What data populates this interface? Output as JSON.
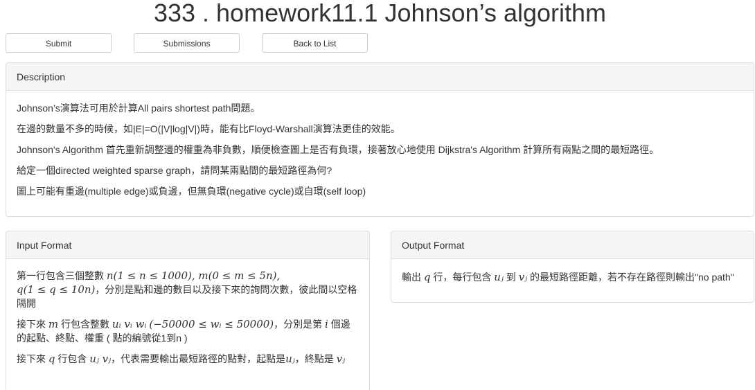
{
  "title": "333 . homework11.1 Johnson’s algorithm",
  "buttons": {
    "submit": "Submit",
    "submissions": "Submissions",
    "back": "Back to List"
  },
  "description": {
    "heading": "Description",
    "lines": [
      "Johnson’s演算法可用於計算All pairs shortest path問題。",
      "在邊的數量不多的時候，如|E|=O(|V|log|V|)時，能有比Floyd-Warshall演算法更佳的效能。",
      "Johnson's Algorithm 首先重新調整邊的權重為非負數，順便檢查圖上是否有負環，接著放心地使用 Dijkstra's Algorithm 計算所有兩點之間的最短路徑。",
      "給定一個directed weighted sparse graph，請問某兩點間的最短路徑為何?",
      "圖上可能有重邊(multiple edge)或負邊，但無負環(negative cycle)或自環(self loop)"
    ]
  },
  "input_format": {
    "heading": "Input Format",
    "p1": {
      "t1": "第一行包含三個整數 ",
      "m1": "n(1 ≤ n ≤ 1000), m(0 ≤ m ≤ 5n),",
      "m2": "q(1 ≤ q ≤ 10n)",
      "t2": "，分別是點和邊的數目以及接下來的詢問次數，彼此間以空格隔開"
    },
    "p2": {
      "t1": "接下來 ",
      "m1": "m",
      "t2": " 行包含整數 ",
      "m2": "uᵢ vᵢ wᵢ",
      "m3": "(−50000 ≤ wᵢ ≤ 50000)",
      "t3": "，分別是第 ",
      "m4": "i",
      "t4": " 個邊的起點、終點、權重 ( 點的編號從1到n )"
    },
    "p3": {
      "t1": "接下來 ",
      "m1": "q",
      "t2": " 行包含 ",
      "m2": "uⱼ vⱼ",
      "t3": "，代表需要輸出最短路徑的點對，起點是",
      "m3": "uⱼ",
      "t4": "，終點是 ",
      "m4": "vⱼ"
    }
  },
  "output_format": {
    "heading": "Output Format",
    "t1": "輸出 ",
    "m1": "q",
    "t2": " 行，每行包含 ",
    "m2": "uⱼ",
    "t3": " 到 ",
    "m3": "vⱼ",
    "t4": " 的最短路徑距離，若不存在路徑則輸出\"no path\""
  }
}
